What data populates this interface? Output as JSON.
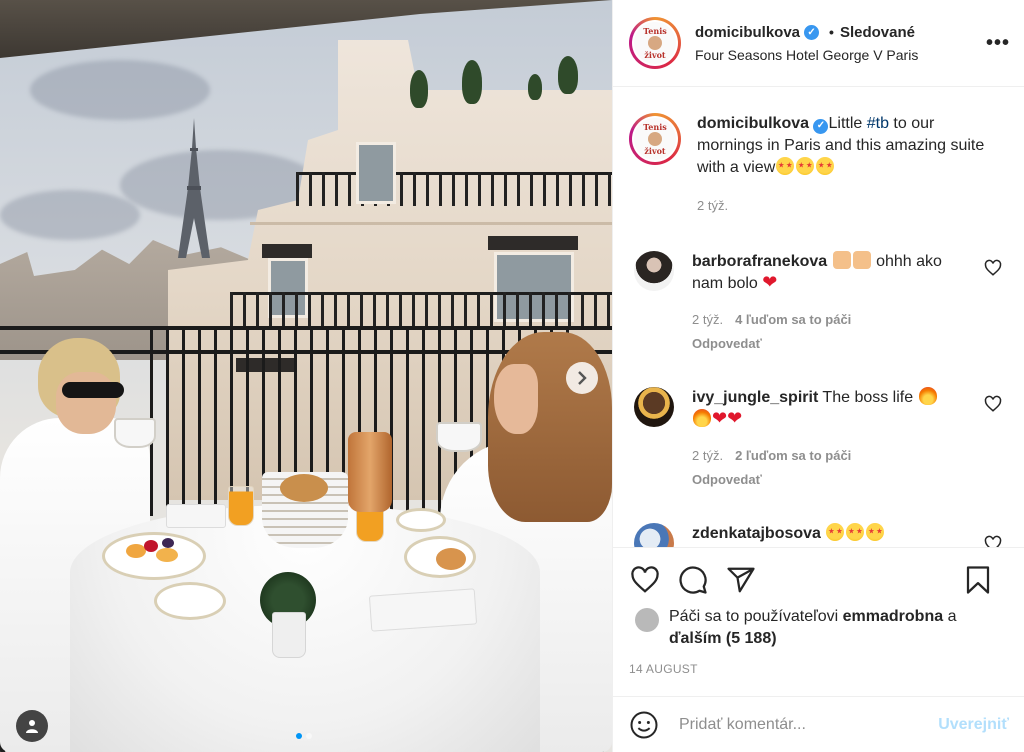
{
  "post": {
    "username": "domicibulkova",
    "follow_separator": "•",
    "follow_state": "Sledované",
    "location": "Four Seasons Hotel George V Paris",
    "more_label": "•••",
    "avatar_text_top": "Tenis",
    "avatar_text_bottom": "život",
    "verified_mark": "✓"
  },
  "caption": {
    "username": "domicibulkova",
    "text_before": "Little ",
    "hashtag": "#tb",
    "text_after": " to our mornings in Paris and this amazing suite with a view",
    "time": "2 týž."
  },
  "comments": [
    {
      "username": "barborafranekova",
      "text": " ohhh ako nam bolo ",
      "time": "2 týž.",
      "likes": "4 ľuďom sa to páči",
      "reply": "Odpovedať"
    },
    {
      "username": "ivy_jungle_spirit",
      "text": " The boss life ",
      "time": "2 týž.",
      "likes": "2 ľuďom sa to páči",
      "reply": "Odpovedať"
    },
    {
      "username": "zdenkatajbosova",
      "text": " "
    }
  ],
  "likes": {
    "prefix": "Páči sa to používateľovi ",
    "user": "emmadrobna",
    "middle": " a ",
    "others": "ďalším (5 188)"
  },
  "date": "14 AUGUST",
  "add_comment": {
    "placeholder": "Pridať komentár...",
    "post_label": "Uverejniť"
  },
  "icons": {
    "heart": "heart-icon",
    "comment": "comment-icon",
    "share": "share-icon",
    "save": "bookmark-icon",
    "emoji": "emoji-icon",
    "next": "chevron-right-icon",
    "tag": "user-tag-icon"
  },
  "colors": {
    "verified": "#3897f0",
    "hashtag": "#00376b",
    "muted": "#8e8e8e",
    "post_button": "#b2dffc",
    "carousel_active_dot": "#0095f6"
  },
  "carousel": {
    "total_slides": 2,
    "current": 1
  }
}
